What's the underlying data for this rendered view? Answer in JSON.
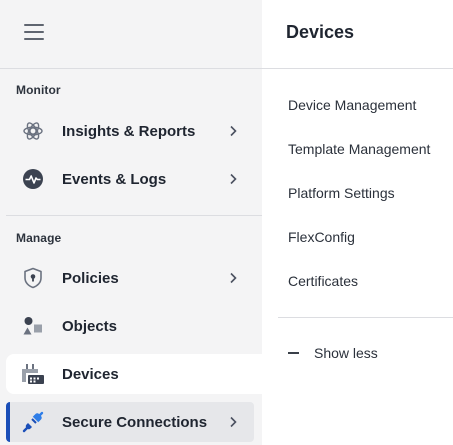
{
  "sidebar": {
    "menu_icon": "hamburger-icon",
    "sections": {
      "monitor": "Monitor",
      "manage": "Manage"
    },
    "items": [
      {
        "label": "Insights & Reports",
        "icon": "insights-icon",
        "has_submenu": true
      },
      {
        "label": "Events & Logs",
        "icon": "pulse-icon",
        "has_submenu": true
      },
      {
        "label": "Policies",
        "icon": "shield-lock-icon",
        "has_submenu": true
      },
      {
        "label": "Objects",
        "icon": "shapes-icon",
        "has_submenu": false
      },
      {
        "label": "Devices",
        "icon": "device-icon",
        "has_submenu": false,
        "state": "active"
      },
      {
        "label": "Secure Connections",
        "icon": "plug-icon",
        "has_submenu": true,
        "state": "selected"
      }
    ],
    "accent_color": "#1b4fb8"
  },
  "flyout": {
    "title": "Devices",
    "links": [
      "Device Management",
      "Template Management",
      "Platform Settings",
      "FlexConfig",
      "Certificates"
    ],
    "show_less": "Show less"
  }
}
